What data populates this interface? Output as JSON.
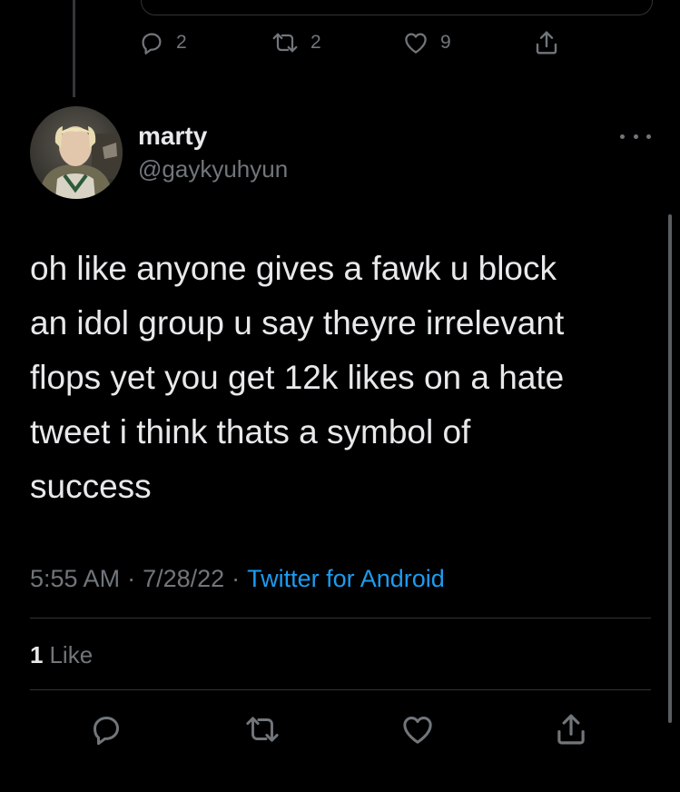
{
  "parent_tweet": {
    "reply_count": "2",
    "retweet_count": "2",
    "like_count": "9"
  },
  "tweet": {
    "display_name": "marty",
    "handle": "@gaykyuhyun",
    "text": "oh like anyone gives a fawk u block\nan idol group u say theyre irrelevant\nflops yet you get 12k likes on a hate\ntweet i think thats a symbol of\nsuccess",
    "time": "5:55 AM",
    "date": "7/28/22",
    "separator": "·",
    "source": "Twitter for Android",
    "like_count": "1",
    "like_label": "Like"
  },
  "icons": {
    "reply": "reply-icon",
    "retweet": "retweet-icon",
    "like": "heart-icon",
    "share": "share-icon",
    "more": "more-icon",
    "avatar": "avatar-photo"
  },
  "colors": {
    "background": "#000000",
    "text_primary": "#e7e9ea",
    "text_secondary": "#71767b",
    "link": "#1d9bf0",
    "divider": "#2f3336"
  }
}
